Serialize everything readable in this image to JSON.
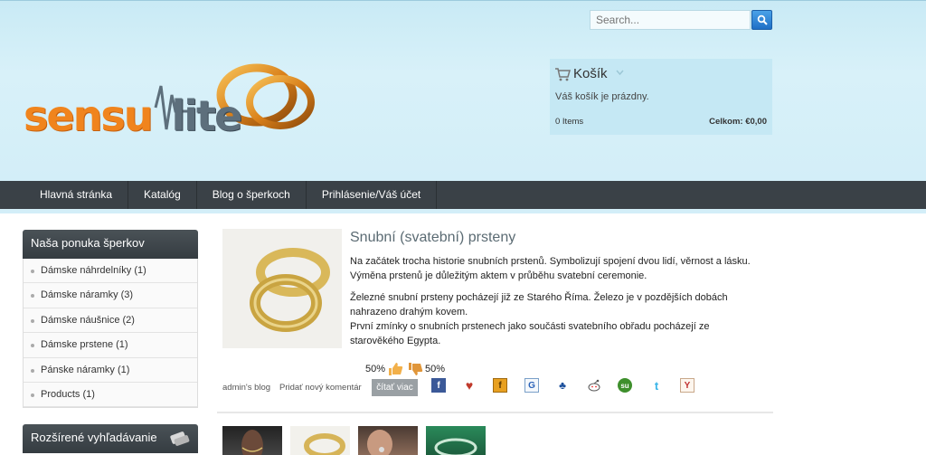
{
  "search": {
    "placeholder": "Search..."
  },
  "logo": {
    "part1": "sensu",
    "part2": "lite"
  },
  "cart": {
    "title": "Košík",
    "empty_text": "Váš košík je prázdny.",
    "items": "0 Items",
    "total": "Celkom: €0,00"
  },
  "nav": {
    "items": [
      {
        "label": "Hlavná stránka"
      },
      {
        "label": "Katalóg"
      },
      {
        "label": "Blog o šperkoch"
      },
      {
        "label": "Prihlásenie/Váš účet"
      }
    ]
  },
  "sidebar": {
    "title": "Naša ponuka šperkov",
    "items": [
      {
        "label": "Dámske náhrdelníky (1)"
      },
      {
        "label": "Dámske náramky (3)"
      },
      {
        "label": "Dámske náušnice (2)"
      },
      {
        "label": "Dámske prstene (1)"
      },
      {
        "label": "Pánske náramky (1)"
      },
      {
        "label": "Products (1)"
      }
    ],
    "advanced_title": "Rozšírené vyhľadávanie"
  },
  "article": {
    "title": "Snubní (svatební) prsteny",
    "p1": "Na začátek trocha historie snubních prstenů. Symbolizují spojení dvou lidí, věrnost a lásku. Výměna prstenů je důležitým aktem v průběhu svatební ceremonie.",
    "p2a": "Železné snubní prsteny pocházejí již ze Starého Říma. Železo je v pozdějších dobách nahrazeno drahým kovem.",
    "p2b": "První zmínky o snubních prstenech jako součásti svatebního obřadu pocházejí ze starověkého Egypta.",
    "rating_up": "50%",
    "rating_down": "50%",
    "author": "admin's blog",
    "add_comment": "Pridať nový komentár",
    "read_more": "čítať viac"
  },
  "colors": {
    "accent": "#f0841d",
    "nav_bg": "#3a4147",
    "header_bg": "#d3eef8"
  }
}
